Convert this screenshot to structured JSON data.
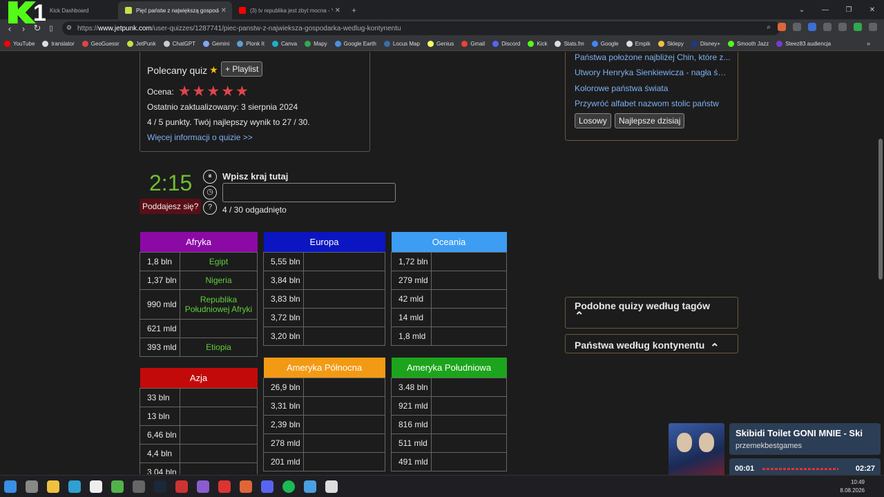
{
  "browser": {
    "tabs": [
      {
        "label": "Kick Dashboard",
        "icon": "kick-icon",
        "color": "#53fc18",
        "active": false
      },
      {
        "label": "Pięć państw z największą gospodarką",
        "icon": "jetpunk-icon",
        "color": "#c6e04a",
        "active": true
      },
      {
        "label": "(3) tv republika jest zbyt mocna - YouTube",
        "icon": "youtube-icon",
        "color": "#ff0000",
        "active": false
      }
    ],
    "new_tab": "+",
    "url_prefix": "https://",
    "url_domain": "www.jetpunk.com",
    "url_path": "/user-quizzes/1287741/piec-panstw-z-najwieksza-gospodarka-wedlug-kontynentu",
    "bookmarks": [
      {
        "label": "YouTube",
        "color": "#ff0000"
      },
      {
        "label": "translator",
        "color": "#dddddd"
      },
      {
        "label": "GeoGuessr",
        "color": "#e04444"
      },
      {
        "label": "JetPunk",
        "color": "#c6e04a"
      },
      {
        "label": "ChatGPT",
        "color": "#cccccc"
      },
      {
        "label": "Gemini",
        "color": "#7fa8f0"
      },
      {
        "label": "Plonk It",
        "color": "#5fa0d0"
      },
      {
        "label": "Canva",
        "color": "#20b0c8"
      },
      {
        "label": "Mapy",
        "color": "#34a853"
      },
      {
        "label": "Google Earth",
        "color": "#4a90e2"
      },
      {
        "label": "Locus Map",
        "color": "#3a6ea8"
      },
      {
        "label": "Genius",
        "color": "#ffff64"
      },
      {
        "label": "Gmail",
        "color": "#ea4335"
      },
      {
        "label": "Discord",
        "color": "#5865f2"
      },
      {
        "label": "Kick",
        "color": "#53fc18"
      },
      {
        "label": "Stats.fm",
        "color": "#dddddd"
      },
      {
        "label": "Google",
        "color": "#4285f4"
      },
      {
        "label": "Empik",
        "color": "#dddddd"
      },
      {
        "label": "Sklepy",
        "color": "#f0c040"
      },
      {
        "label": "Disney+",
        "color": "#1a3a8a"
      },
      {
        "label": "Smooth Jazz",
        "color": "#53fc18"
      },
      {
        "label": "Steez83 audiencja",
        "color": "#7a3ad0"
      }
    ],
    "bookmarks_more": "»"
  },
  "quiz_info": {
    "polecany": "Polecany quiz",
    "playlist_btn": "+ Playlist",
    "ocena_label": "Ocena:",
    "rating": 5,
    "updated": "Ostatnio zaktualizowany: 3 sierpnia 2024",
    "points": "4 / 5 punkty. Twój najlepszy wynik to 27 / 30.",
    "more_info": "Więcej informacji o quizie >>"
  },
  "game": {
    "timer": "2:15",
    "give_up": "Poddajesz się?",
    "input_label": "Wpisz kraj tutaj",
    "input_value": "",
    "progress": "4 / 30 odgadnięto"
  },
  "continents": {
    "afryka": {
      "name": "Afryka",
      "color": "#8b0aa5",
      "rows": [
        [
          "1,8 bln",
          "Egipt"
        ],
        [
          "1,37 bln",
          "Nigeria"
        ],
        [
          "990 mld",
          "Republika Południowej Afryki"
        ],
        [
          "621 mld",
          ""
        ],
        [
          "393 mld",
          "Etiopia"
        ]
      ]
    },
    "europa": {
      "name": "Europa",
      "color": "#0b16c2",
      "rows": [
        [
          "5,55 bln",
          ""
        ],
        [
          "3,84 bln",
          ""
        ],
        [
          "3,83 bln",
          ""
        ],
        [
          "3,72 bln",
          ""
        ],
        [
          "3,20 bln",
          ""
        ]
      ]
    },
    "oceania": {
      "name": "Oceania",
      "color": "#3d9df2",
      "rows": [
        [
          "1,72 bln",
          ""
        ],
        [
          "279 mld",
          ""
        ],
        [
          "42 mld",
          ""
        ],
        [
          "14 mld",
          ""
        ],
        [
          "1,8 mld",
          ""
        ]
      ]
    },
    "azja": {
      "name": "Azja",
      "color": "#c30a0a",
      "rows": [
        [
          "33 bln",
          ""
        ],
        [
          "13 bln",
          ""
        ],
        [
          "6,46 bln",
          ""
        ],
        [
          "4,4 bln",
          ""
        ],
        [
          "3,04 bln",
          ""
        ]
      ]
    },
    "am_pn": {
      "name": "Ameryka Północna",
      "color": "#f39a14",
      "rows": [
        [
          "26,9 bln",
          ""
        ],
        [
          "3,31 bln",
          ""
        ],
        [
          "2,39 bln",
          ""
        ],
        [
          "278 mld",
          ""
        ],
        [
          "201 mld",
          ""
        ]
      ]
    },
    "am_pd": {
      "name": "Ameryka Południowa",
      "color": "#1ca51c",
      "rows": [
        [
          "3.48 bln",
          ""
        ],
        [
          "921 mld",
          ""
        ],
        [
          "816 mld",
          ""
        ],
        [
          "511 mld",
          ""
        ],
        [
          "491 mld",
          ""
        ]
      ]
    }
  },
  "sidebar": {
    "links": [
      "Państwa położone najbliżej Chin, które z...",
      "Utwory Henryka Sienkiewicza - nagła śm...",
      "Kolorowe państwa świata",
      "Przywróć alfabet nazwom stolic państw"
    ],
    "random_btn": "Losowy",
    "best_btn": "Najlepsze dzisiaj",
    "similar_tags": "Podobne quizy według tagów",
    "by_continent": "Państwa według kontynentu",
    "chevron": "⌃"
  },
  "media_overlay": {
    "title": "Skibidi Toilet GONI MNIE - Ski",
    "artist": "przemekbestgames",
    "current_time": "00:01",
    "total_time": "02:27",
    "progress": 0.007
  },
  "taskbar": {
    "time": "10:49",
    "date": "8.08.2026",
    "apps": [
      "windows-start-icon",
      "settings-icon",
      "explorer-icon",
      "edge-icon",
      "capcut-icon",
      "minecraft-icon",
      "app-icon",
      "steam-icon",
      "app-icon",
      "app-icon",
      "app-icon",
      "brave-icon",
      "discord-icon",
      "spotify-icon",
      "notepad-icon",
      "app-icon"
    ]
  },
  "logo_overlay": "K1"
}
